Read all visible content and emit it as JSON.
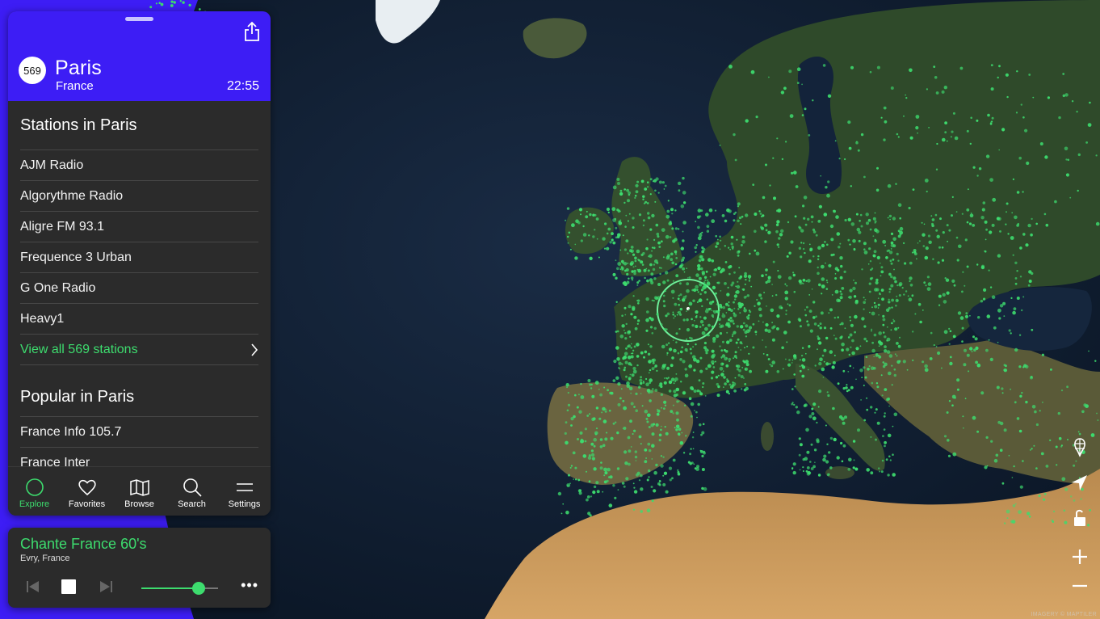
{
  "header": {
    "station_count": "569",
    "city": "Paris",
    "country": "France",
    "local_time": "22:55"
  },
  "stations_section": {
    "title": "Stations in Paris",
    "items": [
      {
        "label": "AJM Radio"
      },
      {
        "label": "Algorythme Radio"
      },
      {
        "label": "Aligre FM 93.1"
      },
      {
        "label": "Frequence 3 Urban"
      },
      {
        "label": "G One Radio"
      },
      {
        "label": "Heavy1"
      }
    ],
    "view_all_label": "View all 569 stations"
  },
  "popular_section": {
    "title": "Popular in Paris",
    "items": [
      {
        "label": "France Info 105.7"
      },
      {
        "label": "France Inter"
      }
    ]
  },
  "tabs": [
    {
      "label": "Explore",
      "icon": "explore-circle-icon",
      "active": true
    },
    {
      "label": "Favorites",
      "icon": "heart-icon"
    },
    {
      "label": "Browse",
      "icon": "map-icon"
    },
    {
      "label": "Search",
      "icon": "search-icon"
    },
    {
      "label": "Settings",
      "icon": "menu-icon"
    }
  ],
  "player": {
    "title": "Chante France 60's",
    "location": "Evry, France",
    "volume": 0.75
  },
  "map_controls": [
    "globe-icon",
    "locate-arrow-icon",
    "lock-icon",
    "zoom-in-icon",
    "zoom-out-icon"
  ],
  "map_credit": "IMAGERY © MAPTILER",
  "colors": {
    "accent_green": "#3ddc6e",
    "header_purple": "#3d1df5",
    "panel_bg": "#2b2b2b"
  }
}
